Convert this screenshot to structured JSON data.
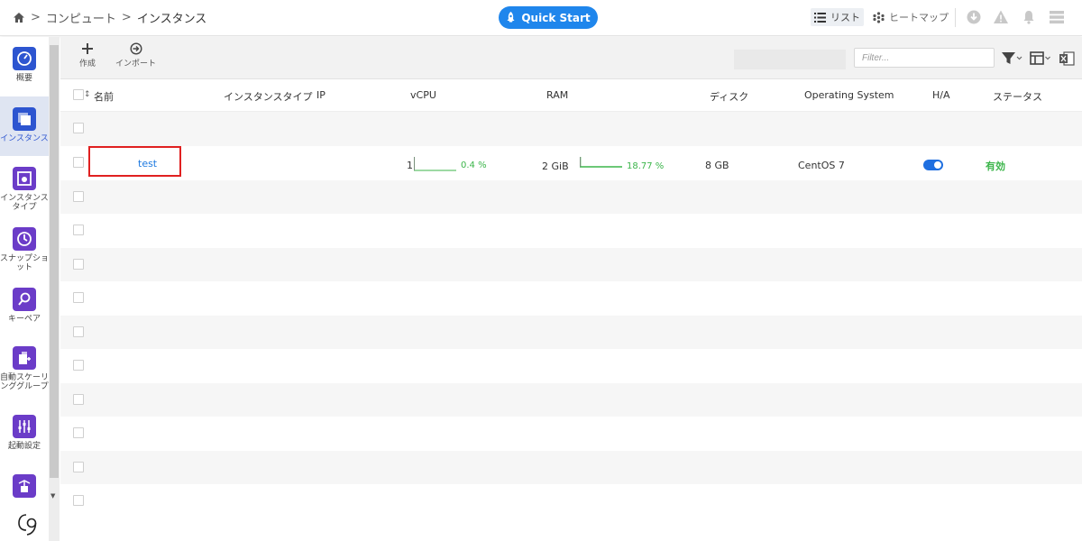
{
  "header": {
    "breadcrumb": [
      "コンピュート",
      "インスタンス"
    ],
    "quick_start": "Quick Start",
    "view_list": "リスト",
    "view_heatmap": "ヒートマップ"
  },
  "sidebar": {
    "items": [
      {
        "label": "概要",
        "icon": "gauge-icon"
      },
      {
        "label": "インスタンス",
        "icon": "instances-icon",
        "active": true
      },
      {
        "label": "インスタンスタイプ",
        "icon": "instance-type-icon"
      },
      {
        "label": "スナップショット",
        "icon": "snapshot-icon"
      },
      {
        "label": "キーペア",
        "icon": "key-icon"
      },
      {
        "label": "自動スケーリンググループ",
        "icon": "autoscale-icon"
      },
      {
        "label": "起動設定",
        "icon": "sliders-icon"
      },
      {
        "label": "",
        "icon": "network-icon"
      }
    ]
  },
  "toolbar": {
    "create": "作成",
    "import": "インポート",
    "filter_placeholder": "Filter..."
  },
  "table": {
    "columns": {
      "name": "名前",
      "type": "インスタンスタイプ",
      "ip": "IP",
      "vcpu": "vCPU",
      "ram": "RAM",
      "disk": "ディスク",
      "os": "Operating System",
      "ha": "H/A",
      "status": "ステータス"
    },
    "rows": [
      {
        "name": "test",
        "vcpu": "1",
        "vcpu_usage": "0.4 %",
        "ram": "2 GiB",
        "ram_usage": "18.77 %",
        "disk": "8 GB",
        "os": "CentOS 7",
        "ha_enabled": true,
        "status": "有効"
      }
    ]
  },
  "colors": {
    "accent": "#1f86ec",
    "sidebar_icon": "#6b3cc8",
    "status_green": "#3bb54a",
    "highlight_red": "#e02020"
  }
}
